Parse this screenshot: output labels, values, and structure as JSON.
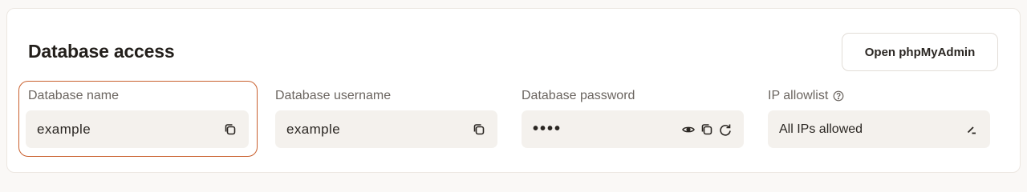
{
  "section": {
    "title": "Database access",
    "open_button_label": "Open phpMyAdmin"
  },
  "fields": {
    "db_name": {
      "label": "Database name",
      "value": "example"
    },
    "db_username": {
      "label": "Database username",
      "value": "example"
    },
    "db_password": {
      "label": "Database password",
      "value": "••••"
    },
    "ip_allowlist": {
      "label": "IP allowlist",
      "value": "All IPs allowed"
    }
  },
  "icons": {
    "copy": "copy-icon",
    "show": "eye-icon",
    "regenerate": "refresh-icon",
    "edit": "edit-icon",
    "help": "help-icon"
  },
  "colors": {
    "focus_ring": "#c9602e",
    "field_bg": "#f4f1ed",
    "label": "#6b6560",
    "text": "#2a2622"
  }
}
